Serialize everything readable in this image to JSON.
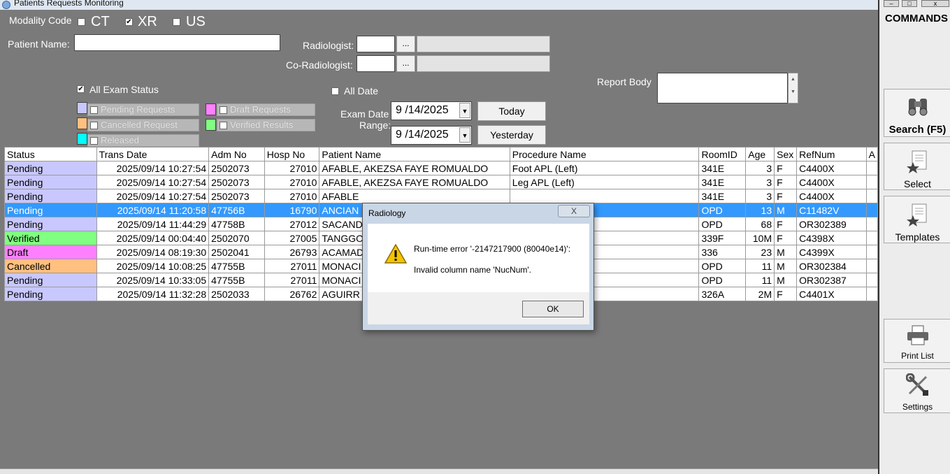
{
  "window": {
    "title": "Patients Requests Monitoring"
  },
  "filters": {
    "modality_label": "Modality Code",
    "modalities": [
      {
        "label": "CT",
        "checked": false
      },
      {
        "label": "XR",
        "checked": true
      },
      {
        "label": "US",
        "checked": false
      }
    ],
    "patient_name_label": "Patient Name:",
    "patient_name_value": "",
    "radiologist_label": "Radiologist:",
    "co_radiologist_label": "Co-Radiologist:",
    "browse_label": "...",
    "report_body_label": "Report Body",
    "all_exam_status_label": "All Exam Status",
    "all_exam_status_checked": true,
    "status_legend": {
      "pending": "Pending Requests",
      "draft": "Draft Requests",
      "cancelled": "Cancelled Request",
      "verified": "Verified Results",
      "released": "Released"
    },
    "all_date_label": "All Date",
    "all_date_checked": false,
    "exam_date_label": "Exam Date",
    "range_label": "Range:",
    "date_from": "9 /14/2025",
    "date_to": "9 /14/2025",
    "today_button": "Today",
    "yesterday_button": "Yesterday"
  },
  "colors": {
    "pending": "#c8c8ff",
    "verified": "#80ff80",
    "draft": "#ff80ff",
    "cancelled": "#ffc080",
    "released": "#00ffff",
    "selected": "#3399ff"
  },
  "grid": {
    "columns": [
      "Status",
      "Trans Date",
      "Adm No",
      "Hosp No",
      "Patient Name",
      "Procedure Name",
      "RoomID",
      "Age",
      "Sex",
      "RefNum",
      "A"
    ],
    "rows": [
      {
        "status": "Pending",
        "trans_date": "2025/09/14 10:27:54",
        "adm_no": "2502073",
        "hosp_no": "27010",
        "patient": "AFABLE, AKEZSA  FAYE ROMUALDO",
        "procedure": "Foot APL (Left)",
        "room": "341E",
        "age": "3",
        "sex": "F",
        "refnum": "C4400X"
      },
      {
        "status": "Pending",
        "trans_date": "2025/09/14 10:27:54",
        "adm_no": "2502073",
        "hosp_no": "27010",
        "patient": "AFABLE, AKEZSA  FAYE ROMUALDO",
        "procedure": "Leg APL (Left)",
        "room": "341E",
        "age": "3",
        "sex": "F",
        "refnum": "C4400X"
      },
      {
        "status": "Pending",
        "trans_date": "2025/09/14 10:27:54",
        "adm_no": "2502073",
        "hosp_no": "27010",
        "patient": "AFABLE",
        "procedure": "",
        "room": "341E",
        "age": "3",
        "sex": "F",
        "refnum": "C4400X"
      },
      {
        "status": "Pending",
        "trans_date": "2025/09/14 11:20:58",
        "adm_no": "47756B",
        "hosp_no": "16790",
        "patient": "ANCIAN",
        "procedure": "",
        "room": "OPD",
        "age": "13",
        "sex": "M",
        "refnum": "C11482V",
        "selected": true
      },
      {
        "status": "Pending",
        "trans_date": "2025/09/14 11:44:29",
        "adm_no": "47758B",
        "hosp_no": "27012",
        "patient": "SACAND",
        "procedure": "",
        "room": "OPD",
        "age": "68",
        "sex": "F",
        "refnum": "OR302389"
      },
      {
        "status": "Verified",
        "trans_date": "2025/09/14 00:04:40",
        "adm_no": "2502070",
        "hosp_no": "27005",
        "patient": "TANGGO",
        "procedure": "",
        "room": "339F",
        "age": "10M",
        "sex": "F",
        "refnum": "C4398X"
      },
      {
        "status": "Draft",
        "trans_date": "2025/09/14 08:19:30",
        "adm_no": "2502041",
        "hosp_no": "26793",
        "patient": "ACAMAD",
        "procedure": "",
        "room": "336",
        "age": "23",
        "sex": "M",
        "refnum": "C4399X"
      },
      {
        "status": "Cancelled",
        "trans_date": "2025/09/14 10:08:25",
        "adm_no": "47755B",
        "hosp_no": "27011",
        "patient": "MONACI",
        "procedure": "",
        "room": "OPD",
        "age": "11",
        "sex": "M",
        "refnum": "OR302384"
      },
      {
        "status": "Pending",
        "trans_date": "2025/09/14 10:33:05",
        "adm_no": "47755B",
        "hosp_no": "27011",
        "patient": "MONACI",
        "procedure": "",
        "room": "OPD",
        "age": "11",
        "sex": "M",
        "refnum": "OR302387"
      },
      {
        "status": "Pending",
        "trans_date": "2025/09/14 11:32:28",
        "adm_no": "2502033",
        "hosp_no": "26762",
        "patient": "AGUIRR",
        "procedure": "",
        "room": "326A",
        "age": "2M",
        "sex": "F",
        "refnum": "C4401X"
      }
    ]
  },
  "commands": {
    "title": "COMMANDS",
    "search": "Search (F5)",
    "select": "Select",
    "templates": "Templates",
    "print_list": "Print List",
    "settings": "Settings"
  },
  "dialog": {
    "title": "Radiology",
    "close": "X",
    "line1": "Run-time error '-2147217900 (80040e14)':",
    "line2": "Invalid column name 'NucNum'.",
    "ok": "OK"
  }
}
